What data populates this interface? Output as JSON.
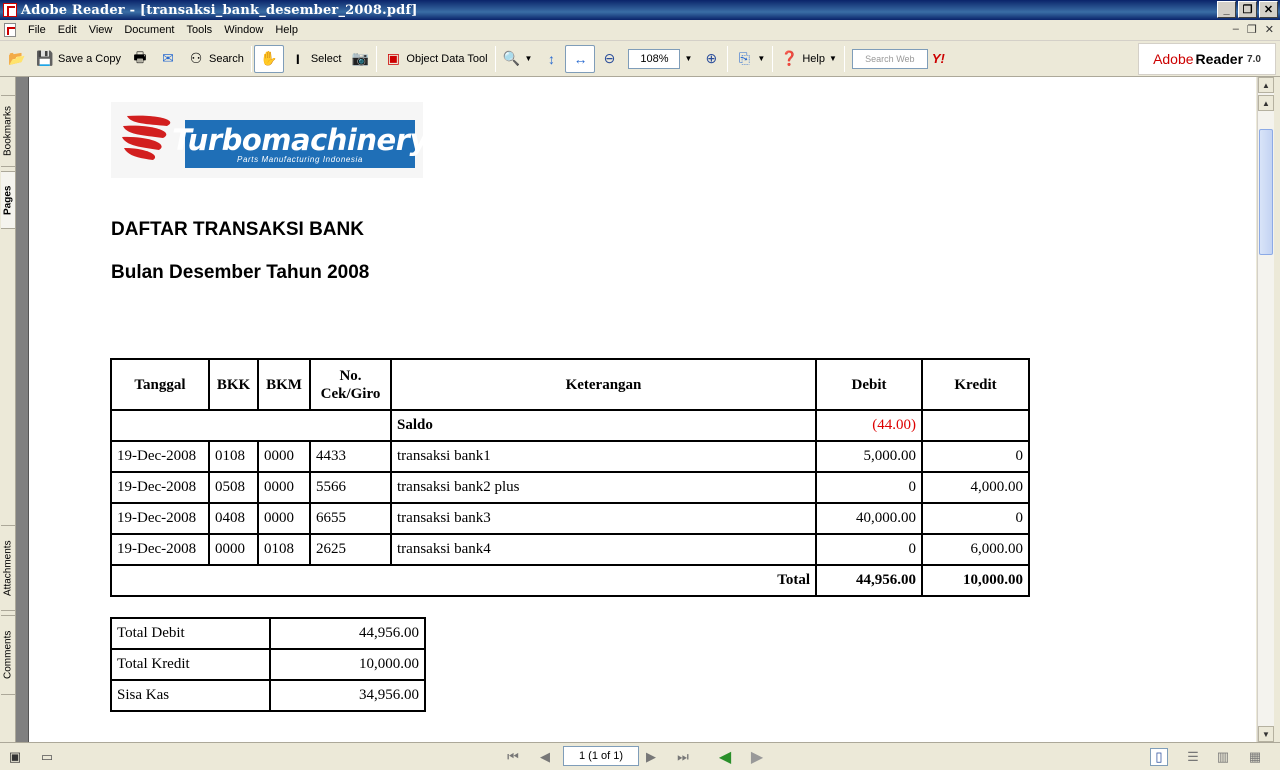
{
  "window": {
    "title": "Adobe Reader - [transaksi_bank_desember_2008.pdf]"
  },
  "menu": [
    "File",
    "Edit",
    "View",
    "Document",
    "Tools",
    "Window",
    "Help"
  ],
  "toolbar": {
    "save_copy": "Save a Copy",
    "search": "Search",
    "select": "Select",
    "object_data_tool": "Object Data Tool",
    "zoom": "108%",
    "help": "Help",
    "search_web_placeholder": "Search Web",
    "yahoo": "Y!"
  },
  "brand": {
    "adobe": "Adobe",
    "reader": "Reader",
    "version": "7.0"
  },
  "nav_tabs": {
    "bookmarks": "Bookmarks",
    "pages": "Pages",
    "attachments": "Attachments",
    "comments": "Comments"
  },
  "document": {
    "logo_name": "Turbomachinery",
    "logo_tagline": "Parts Manufacturing Indonesia",
    "heading": "DAFTAR TRANSAKSI BANK",
    "subheading": "Bulan Desember Tahun 2008",
    "table": {
      "headers": {
        "tanggal": "Tanggal",
        "bkk": "BKK",
        "bkm": "BKM",
        "nocek_1": "No.",
        "nocek_2": "Cek/Giro",
        "keterangan": "Keterangan",
        "debit": "Debit",
        "kredit": "Kredit"
      },
      "saldo": {
        "label": "Saldo",
        "debit": "(44.00)"
      },
      "rows": [
        {
          "tanggal": "19-Dec-2008",
          "bkk": "0108",
          "bkm": "0000",
          "cek": "4433",
          "ket": "transaksi bank1",
          "debit": "5,000.00",
          "kredit": "0"
        },
        {
          "tanggal": "19-Dec-2008",
          "bkk": "0508",
          "bkm": "0000",
          "cek": "5566",
          "ket": "transaksi bank2 plus",
          "debit": "0",
          "kredit": "4,000.00"
        },
        {
          "tanggal": "19-Dec-2008",
          "bkk": "0408",
          "bkm": "0000",
          "cek": "6655",
          "ket": "transaksi bank3",
          "debit": "40,000.00",
          "kredit": "0"
        },
        {
          "tanggal": "19-Dec-2008",
          "bkk": "0000",
          "bkm": "0108",
          "cek": "2625",
          "ket": "transaksi bank4",
          "debit": "0",
          "kredit": "6,000.00"
        }
      ],
      "total": {
        "label": "Total",
        "debit": "44,956.00",
        "kredit": "10,000.00"
      }
    },
    "summary": [
      {
        "label": "Total Debit",
        "value": "44,956.00"
      },
      {
        "label": "Total Kredit",
        "value": "10,000.00"
      },
      {
        "label": "Sisa Kas",
        "value": "34,956.00"
      }
    ]
  },
  "status": {
    "page_indicator": "1  (1 of 1)"
  }
}
